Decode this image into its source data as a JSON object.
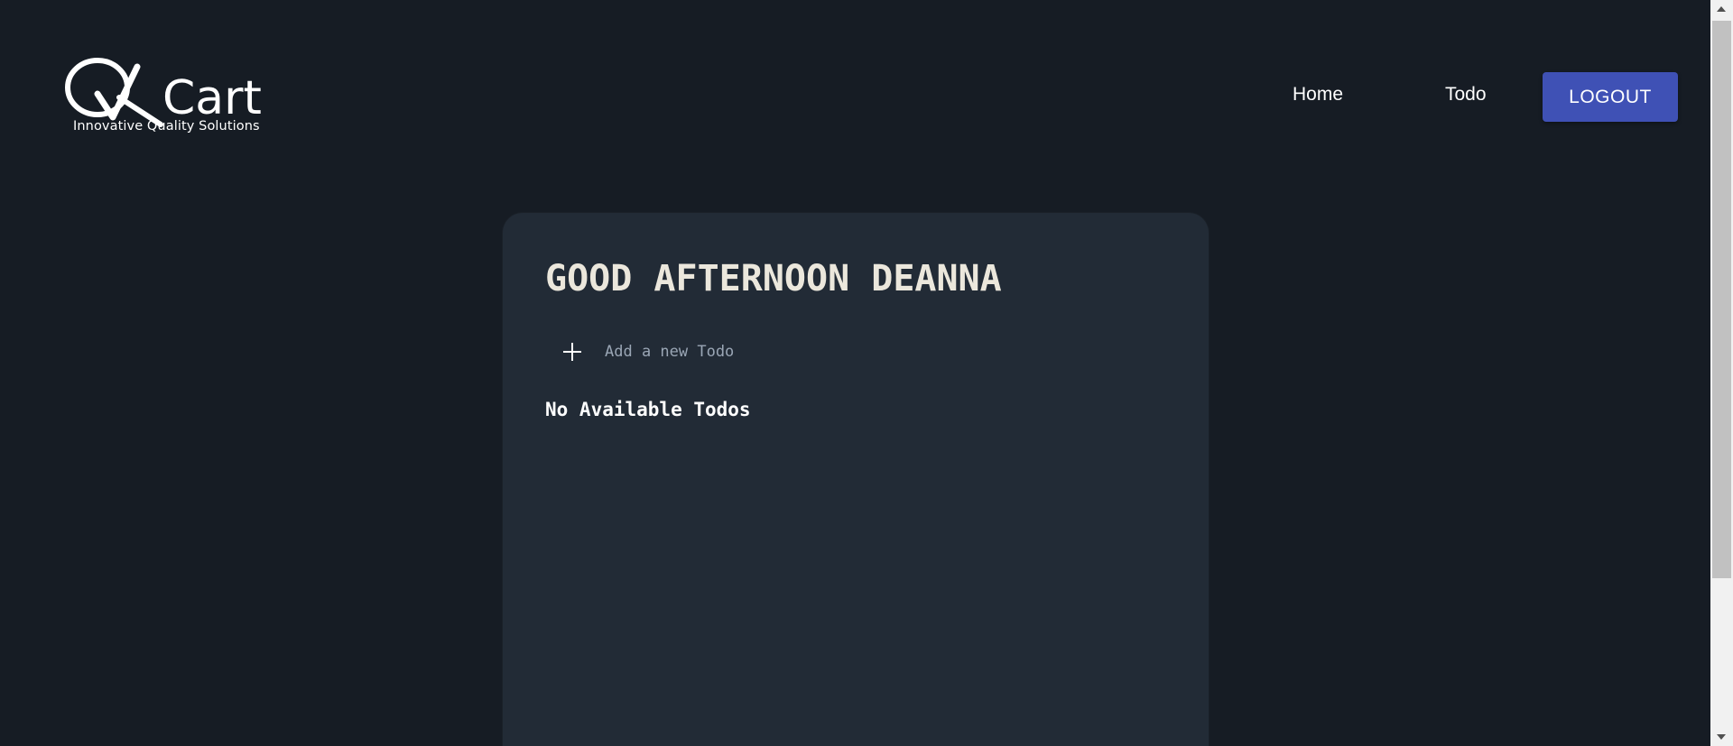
{
  "header": {
    "logo_text": "QACart",
    "logo_tagline": "Innovative Quality Solutions",
    "nav": {
      "home_label": "Home",
      "todo_label": "Todo"
    },
    "logout_label": "LOGOUT"
  },
  "main": {
    "greeting": "GOOD AFTERNOON DEANNA",
    "add_todo": {
      "placeholder": "Add a new Todo",
      "value": ""
    },
    "empty_message": "No Available Todos"
  },
  "colors": {
    "background": "#161c24",
    "card": "#222b36",
    "accent": "#3f51b5",
    "greeting_text": "#ebe7dc"
  },
  "icons": {
    "add": "plus-icon",
    "scroll_up": "chevron-up-icon",
    "scroll_down": "chevron-down-icon"
  }
}
